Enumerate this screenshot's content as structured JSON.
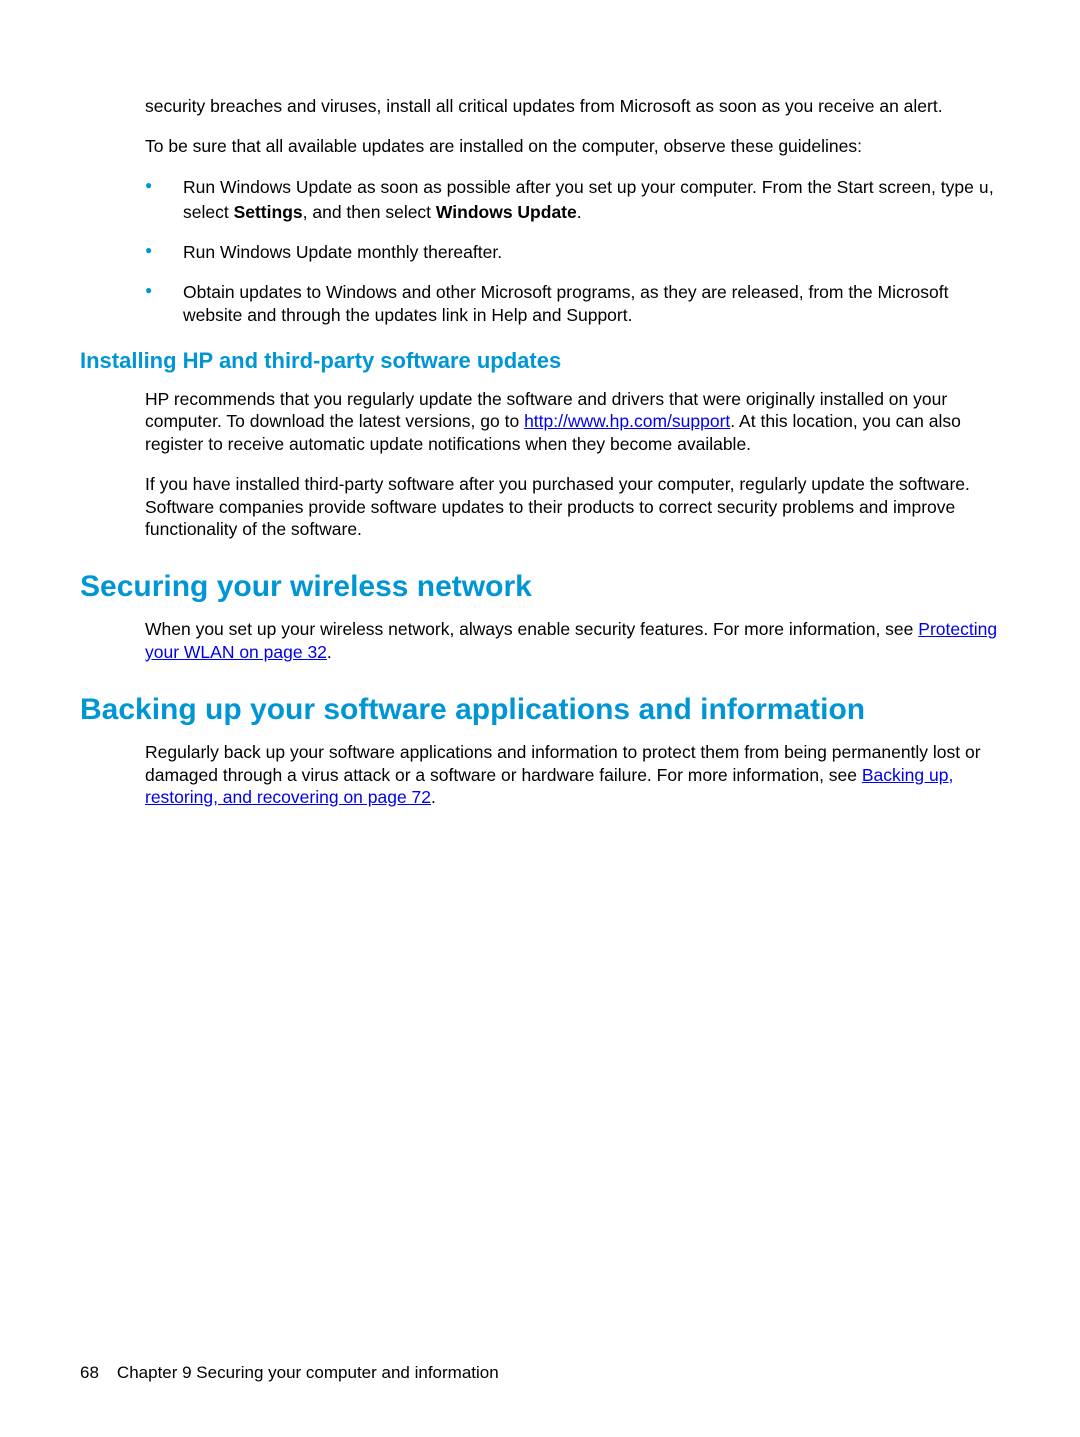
{
  "intro": {
    "p1": "security breaches and viruses, install all critical updates from Microsoft as soon as you receive an alert.",
    "p2": "To be sure that all available updates are installed on the computer, observe these guidelines:"
  },
  "bullets": {
    "b1_a": "Run Windows Update as soon as possible after you set up your computer. From the Start screen, type ",
    "b1_u": "u",
    "b1_b": ", select ",
    "b1_settings": "Settings",
    "b1_c": ", and then select ",
    "b1_wu": "Windows Update",
    "b1_d": ".",
    "b2": "Run Windows Update monthly thereafter.",
    "b3": "Obtain updates to Windows and other Microsoft programs, as they are released, from the Microsoft website and through the updates link in Help and Support."
  },
  "section_hp": {
    "heading": "Installing HP and third-party software updates",
    "p1_a": "HP recommends that you regularly update the software and drivers that were originally installed on your computer. To download the latest versions, go to ",
    "p1_link": "http://www.hp.com/support",
    "p1_b": ". At this location, you can also register to receive automatic update notifications when they become available.",
    "p2": "If you have installed third-party software after you purchased your computer, regularly update the software. Software companies provide software updates to their products to correct security problems and improve functionality of the software."
  },
  "section_wireless": {
    "heading": "Securing your wireless network",
    "p1_a": "When you set up your wireless network, always enable security features. For more information, see ",
    "p1_link": "Protecting your WLAN on page 32",
    "p1_b": "."
  },
  "section_backup": {
    "heading": "Backing up your software applications and information",
    "p1_a": "Regularly back up your software applications and information to protect them from being permanently lost or damaged through a virus attack or a software or hardware failure. For more information, see ",
    "p1_link": "Backing up, restoring, and recovering on page 72",
    "p1_b": "."
  },
  "footer": {
    "page": "68",
    "chapter": "Chapter 9   Securing your computer and information"
  }
}
